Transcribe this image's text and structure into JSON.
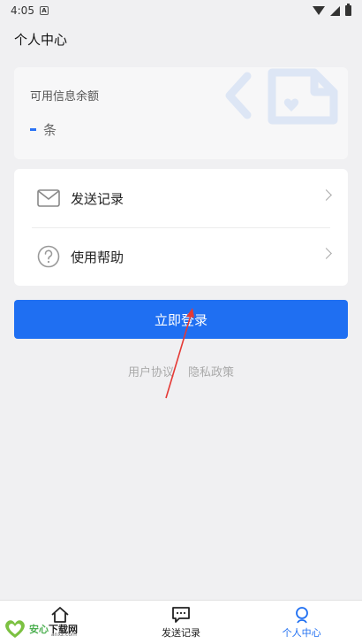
{
  "status_bar": {
    "time": "4:05",
    "notification_badge": "A"
  },
  "header": {
    "title": "个人中心"
  },
  "balance": {
    "label": "可用信息余额",
    "value": "-",
    "unit": "条"
  },
  "menu": {
    "send_records": "发送记录",
    "help": "使用帮助"
  },
  "actions": {
    "login": "立即登录"
  },
  "links": {
    "user_agreement": "用户协议",
    "privacy_policy": "隐私政策"
  },
  "bottom_nav": [
    {
      "label": "",
      "icon": "home-icon",
      "active": false
    },
    {
      "label": "发送记录",
      "icon": "chat-icon",
      "active": false
    },
    {
      "label": "个人中心",
      "icon": "person-icon",
      "active": true
    }
  ],
  "watermark": {
    "text_green": "安心",
    "text_black": "下载网",
    "url": "anxz.com"
  },
  "colors": {
    "primary": "#1f6ff2",
    "background": "#f0f0f2",
    "annotation": "#e53935"
  }
}
